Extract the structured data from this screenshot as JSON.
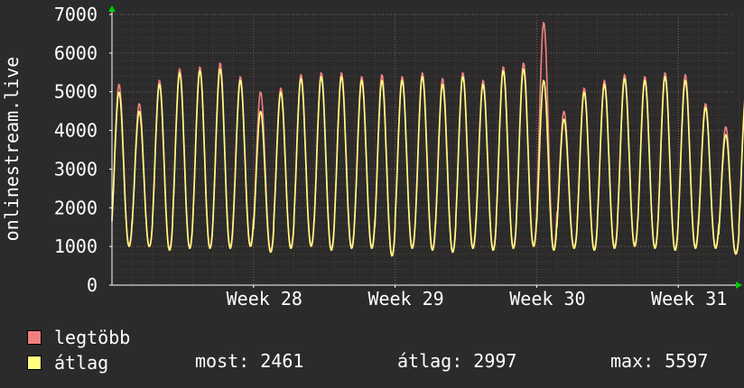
{
  "colors": {
    "background": "#2b2b2b",
    "plot_background": "#2b2b2b",
    "grid_minor": "#5a3a3a",
    "grid_major": "#7a5a5a",
    "axis": "#ffffff",
    "max_series": "#f08080",
    "avg_series": "#ffff80",
    "arrow": "#00cc00"
  },
  "chart_data": {
    "type": "line",
    "ylabel": "onlinestream.live",
    "ylim": [
      0,
      7000
    ],
    "yticks": [
      0,
      1000,
      2000,
      3000,
      4000,
      5000,
      6000,
      7000
    ],
    "x_range_days": [
      0,
      35
    ],
    "xticks": [
      {
        "day": 7,
        "label": "Week 28"
      },
      {
        "day": 14,
        "label": "Week 29"
      },
      {
        "day": 21,
        "label": "Week 30"
      },
      {
        "day": 28,
        "label": "Week 31"
      }
    ],
    "grid": true,
    "series": [
      {
        "name": "legtöbb",
        "color": "#f08080",
        "daily_peaks": [
          5200,
          4700,
          5300,
          5600,
          5650,
          5750,
          5400,
          5000,
          5100,
          5450,
          5500,
          5500,
          5400,
          5450,
          5400,
          5500,
          5350,
          5500,
          5300,
          5650,
          5750,
          6800,
          4500,
          5100,
          5300,
          5450,
          5400,
          5500,
          5450,
          4700,
          4100,
          5000
        ],
        "daily_troughs": [
          1050,
          1000,
          950,
          1000,
          1000,
          1000,
          1050,
          900,
          1000,
          1050,
          950,
          1000,
          1000,
          800,
          1000,
          950,
          900,
          1000,
          950,
          1000,
          1050,
          950,
          1000,
          950,
          1000,
          1050,
          1000,
          950,
          1000,
          1000,
          850,
          900
        ]
      },
      {
        "name": "átlag",
        "color": "#ffff80",
        "daily_peaks": [
          5000,
          4500,
          5200,
          5500,
          5550,
          5600,
          5300,
          4500,
          5000,
          5350,
          5400,
          5400,
          5300,
          5300,
          5300,
          5400,
          5200,
          5400,
          5200,
          5550,
          5600,
          5300,
          4300,
          5000,
          5200,
          5350,
          5300,
          5400,
          5300,
          4600,
          3900,
          4900
        ],
        "daily_troughs": [
          1000,
          1000,
          900,
          950,
          950,
          950,
          1000,
          850,
          950,
          1000,
          900,
          950,
          950,
          750,
          950,
          900,
          850,
          950,
          900,
          950,
          1000,
          900,
          950,
          900,
          950,
          1000,
          950,
          900,
          950,
          950,
          800,
          850
        ]
      }
    ]
  },
  "legend": {
    "max_label": "legtöbb",
    "avg_label": "átlag",
    "now_text": "most: 2461",
    "avg_text": "átlag: 2997",
    "max_text": "max: 5597"
  }
}
